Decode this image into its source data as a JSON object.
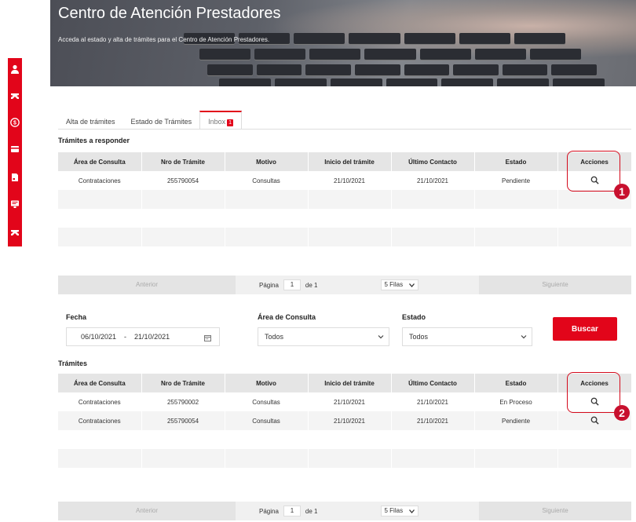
{
  "header": {
    "title": "Centro de Atención Prestadores",
    "subtitle": "Acceda al estado y alta de trámites para el Centro de Atención Prestadores."
  },
  "sidebar": {
    "icons": [
      "user-icon",
      "handshake-icon",
      "money-icon",
      "card-icon",
      "document-icon",
      "monitor-icon",
      "handshake-icon"
    ]
  },
  "tabs": [
    {
      "label": "Alta de trámites"
    },
    {
      "label": "Estado de Trámites"
    },
    {
      "label": "Inbox",
      "badge": "1"
    }
  ],
  "responder": {
    "title": "Trámites a responder",
    "columns": [
      "Área de Consulta",
      "Nro de Trámite",
      "Motivo",
      "Inicio del trámite",
      "Último Contacto",
      "Estado",
      "Acciones"
    ],
    "rows": [
      [
        "Contrataciones",
        "255790054",
        "Consultas",
        "21/10/2021",
        "21/10/2021",
        "Pendiente"
      ]
    ],
    "pager": {
      "prev": "Anterior",
      "page_label": "Página",
      "page": "1",
      "of": "de 1",
      "rows_select": "5 Filas",
      "next": "Siguiente"
    }
  },
  "filters": {
    "fecha_label": "Fecha",
    "fecha_from": "06/10/2021",
    "fecha_sep": "-",
    "fecha_to": "21/10/2021",
    "area_label": "Área de Consulta",
    "area_value": "Todos",
    "estado_label": "Estado",
    "estado_value": "Todos",
    "search_button": "Buscar"
  },
  "tramites": {
    "title": "Trámites",
    "columns": [
      "Área de Consulta",
      "Nro de Trámite",
      "Motivo",
      "Inicio del trámite",
      "Último Contacto",
      "Estado",
      "Acciones"
    ],
    "rows": [
      [
        "Contrataciones",
        "255790002",
        "Consultas",
        "21/10/2021",
        "21/10/2021",
        "En Proceso"
      ],
      [
        "Contrataciones",
        "255790054",
        "Consultas",
        "21/10/2021",
        "21/10/2021",
        "Pendiente"
      ]
    ],
    "pager": {
      "prev": "Anterior",
      "page_label": "Página",
      "page": "1",
      "of": "de 1",
      "rows_select": "5 Filas",
      "next": "Siguiente"
    }
  },
  "annotations": {
    "marker1": "1",
    "marker2": "2"
  },
  "colors": {
    "accent": "#e2051a",
    "header_bg": "#e5e5e5"
  }
}
